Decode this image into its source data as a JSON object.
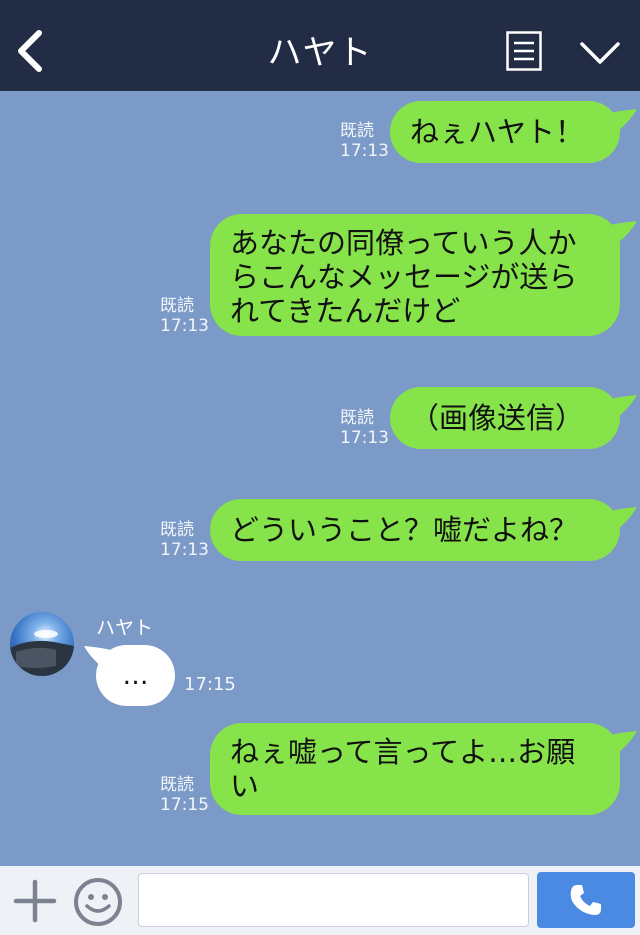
{
  "header": {
    "title": "ハヤト",
    "back_icon": "chevron-left-icon",
    "menu_icon": "menu-list-icon",
    "collapse_icon": "chevron-down-icon"
  },
  "messages": [
    {
      "direction": "out",
      "lines": [
        "ねぇハヤト！"
      ],
      "read": "既読",
      "time": "17:13"
    },
    {
      "direction": "out",
      "lines": [
        "あなたの同僚っていう人か",
        "らこんなメッセージが送ら",
        "れてきたんだけど"
      ],
      "read": "既読",
      "time": "17:13"
    },
    {
      "direction": "out",
      "lines": [
        "（画像送信）"
      ],
      "read": "既読",
      "time": "17:13"
    },
    {
      "direction": "out",
      "lines": [
        "どういうこと？嘘だよね？"
      ],
      "read": "既読",
      "time": "17:13"
    },
    {
      "direction": "in",
      "sender": "ハヤト",
      "lines": [
        "…"
      ],
      "time": "17:15"
    },
    {
      "direction": "out",
      "lines": [
        "ねぇ嘘って言ってよ…お願",
        "い"
      ],
      "read": "既読",
      "time": "17:15"
    }
  ],
  "input": {
    "value": "",
    "placeholder": ""
  },
  "colors": {
    "header_bg": "#232c45",
    "chat_bg": "#7b9ac7",
    "bubble_out": "#86e34a",
    "bubble_in": "#ffffff",
    "call_button": "#4b8ae2"
  }
}
